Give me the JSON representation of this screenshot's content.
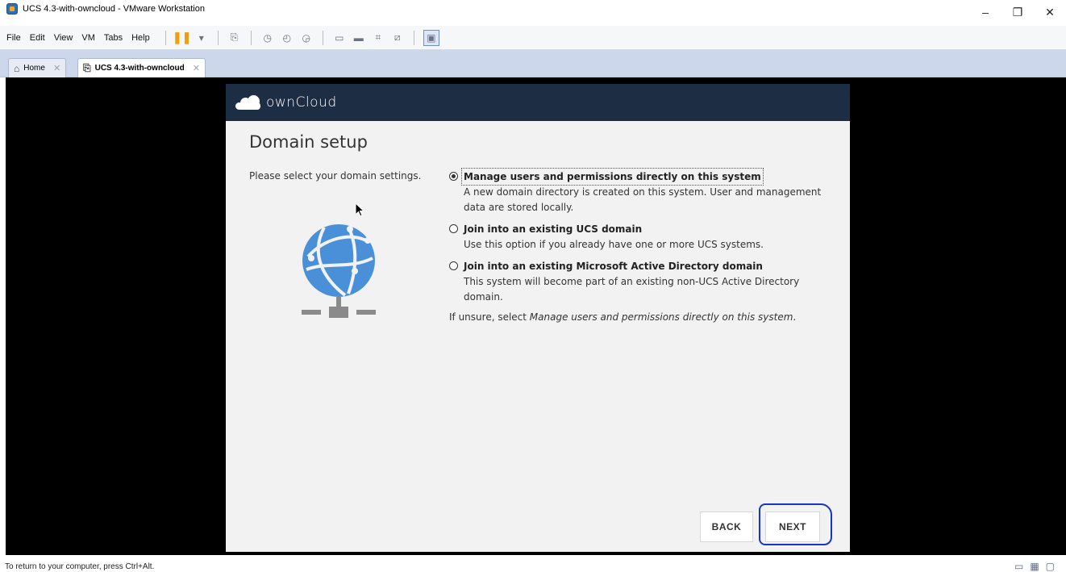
{
  "window": {
    "title": "UCS 4.3-with-owncloud - VMware Workstation",
    "controls": {
      "minimize": "–",
      "restore": "❐",
      "close": "✕"
    }
  },
  "menubar": {
    "items": [
      "File",
      "Edit",
      "View",
      "VM",
      "Tabs",
      "Help"
    ]
  },
  "tabs": [
    {
      "label": "Home",
      "icon": "home-icon",
      "active": false
    },
    {
      "label": "UCS 4.3-with-owncloud",
      "icon": "vm-icon",
      "active": true
    }
  ],
  "owncloud": {
    "logo_text": "ownCloud"
  },
  "setup": {
    "title": "Domain setup",
    "intro": "Please select your domain settings.",
    "options": [
      {
        "label": "Manage users and permissions directly on this system",
        "description": "A new domain directory is created on this system. User and management data are stored locally.",
        "checked": true
      },
      {
        "label": "Join into an existing UCS domain",
        "description": "Use this option if you already have one or more UCS systems.",
        "checked": false
      },
      {
        "label": "Join into an existing Microsoft Active Directory domain",
        "description": "This system will become part of an existing non-UCS Active Directory domain.",
        "checked": false
      }
    ],
    "hint_prefix": "If unsure, select ",
    "hint_emphasis": "Manage users and permissions directly on this system",
    "hint_suffix": ".",
    "back_label": "BACK",
    "next_label": "NEXT"
  },
  "statusbar": {
    "text": "To return to your computer, press Ctrl+Alt."
  },
  "colors": {
    "header": "#1d2d44",
    "body": "#f2f2f2",
    "globe": "#4a90d9",
    "annotation": "#1536c8"
  }
}
